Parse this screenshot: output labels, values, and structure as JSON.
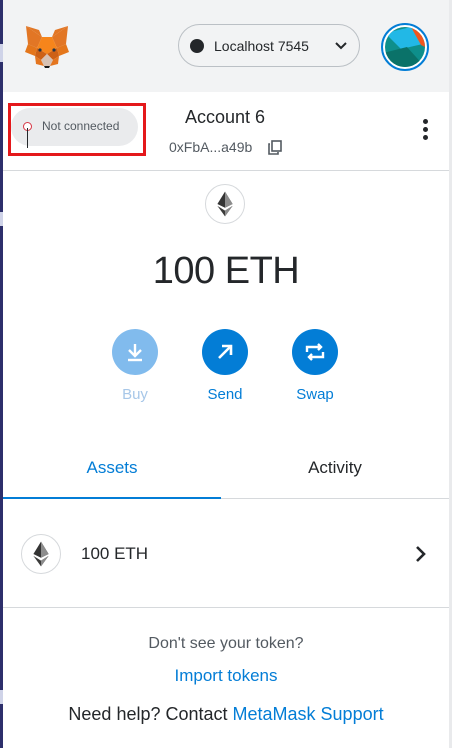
{
  "header": {
    "network": {
      "label": "Localhost 7545"
    }
  },
  "account": {
    "connection_status": "Not connected",
    "name": "Account 6",
    "address": "0xFbA...a49b"
  },
  "balance": {
    "amount": "100 ETH"
  },
  "actions": [
    {
      "label": "Buy",
      "icon": "download-icon",
      "enabled": false
    },
    {
      "label": "Send",
      "icon": "arrow-up-right-icon",
      "enabled": true
    },
    {
      "label": "Swap",
      "icon": "swap-arrows-icon",
      "enabled": true
    }
  ],
  "tabs": [
    {
      "label": "Assets",
      "active": true
    },
    {
      "label": "Activity",
      "active": false
    }
  ],
  "assets": [
    {
      "label": "100 ETH",
      "icon": "eth-icon"
    }
  ],
  "footer": {
    "question": "Don't see your token?",
    "import_link": "Import tokens",
    "help_prefix": "Need help? Contact ",
    "help_link": "MetaMask Support"
  },
  "colors": {
    "accent": "#037dd6",
    "highlight_box": "#e4181b",
    "header_bg": "#f2f3f4"
  }
}
